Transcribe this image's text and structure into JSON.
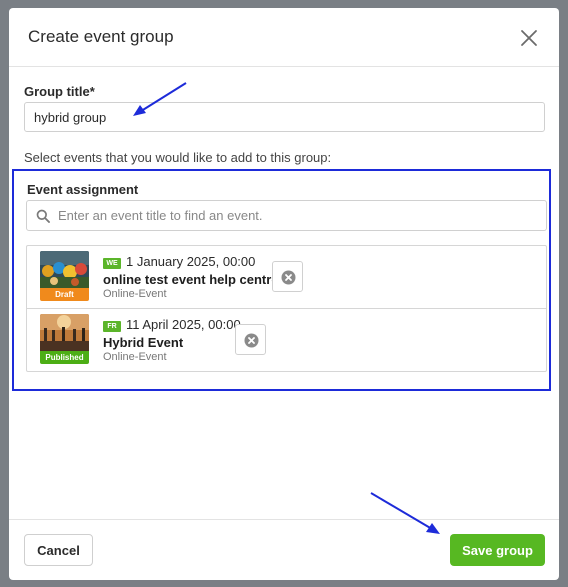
{
  "modal": {
    "title": "Create event group",
    "close_icon": "close-icon"
  },
  "form": {
    "group_title_label": "Group title*",
    "group_title_value": "hybrid group",
    "select_hint": "Select events that you would like to add to this group:"
  },
  "assignment": {
    "label": "Event assignment",
    "search_placeholder": "Enter an event title to find an event.",
    "search_icon": "search-icon",
    "events": [
      {
        "day": "WE",
        "date": "1 January 2025, 00:00",
        "title": "online test event help centre",
        "type": "Online-Event",
        "status": "Draft",
        "status_color": "#f08a1c",
        "remove_icon": "remove-icon"
      },
      {
        "day": "FR",
        "date": "11 April 2025, 00:00",
        "title": "Hybrid Event",
        "type": "Online-Event",
        "status": "Published",
        "status_color": "#4cae15",
        "remove_icon": "remove-icon"
      }
    ]
  },
  "footer": {
    "cancel_label": "Cancel",
    "save_label": "Save group"
  },
  "colors": {
    "accent_green": "#57b822",
    "highlight_blue": "#1d2bd9",
    "overlay": "#7a7f85"
  }
}
